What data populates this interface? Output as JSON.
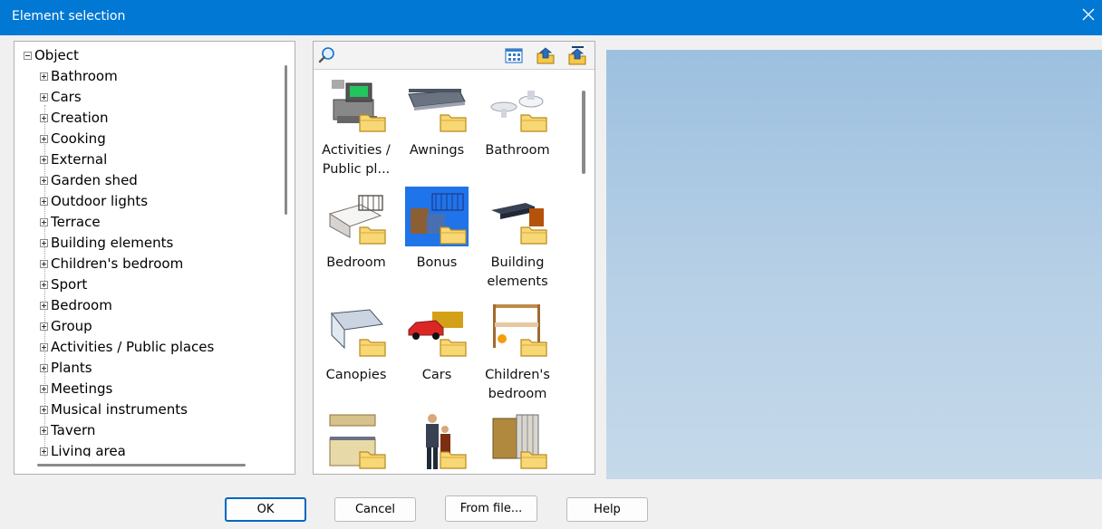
{
  "window": {
    "title": "Element selection"
  },
  "tree": {
    "root": "Object",
    "items": [
      "Bathroom",
      "Cars",
      "Creation",
      "Cooking",
      "External",
      "Garden shed",
      "Outdoor lights",
      "Terrace",
      "Building elements",
      "Children's bedroom",
      "Sport",
      "Bedroom",
      "Group",
      "Activities / Public places",
      "Plants",
      "Meetings",
      "Musical instruments",
      "Tavern",
      "Living area"
    ]
  },
  "tiles": [
    {
      "line1": "Activities /",
      "line2": "Public pl..."
    },
    {
      "line1": "Awnings",
      "line2": ""
    },
    {
      "line1": "Bathroom",
      "line2": ""
    },
    {
      "line1": "Bedroom",
      "line2": ""
    },
    {
      "line1": "Bonus",
      "line2": ""
    },
    {
      "line1": "Building",
      "line2": "elements"
    },
    {
      "line1": "Canopies",
      "line2": ""
    },
    {
      "line1": "Cars",
      "line2": ""
    },
    {
      "line1": "Children's",
      "line2": "bedroom"
    }
  ],
  "buttons": {
    "ok": "OK",
    "cancel": "Cancel",
    "from_file": "From file...",
    "help": "Help"
  },
  "icons": {
    "search": "search-icon",
    "view": "view-mode-icon",
    "up": "folder-up-icon",
    "top": "folder-top-icon",
    "close": "close-icon",
    "folder": "folder-icon"
  },
  "colors": {
    "titlebar": "#0078d4",
    "selection": "#1e74e8",
    "preview_top": "#9cc0df",
    "preview_bottom": "#c5d9ea"
  }
}
